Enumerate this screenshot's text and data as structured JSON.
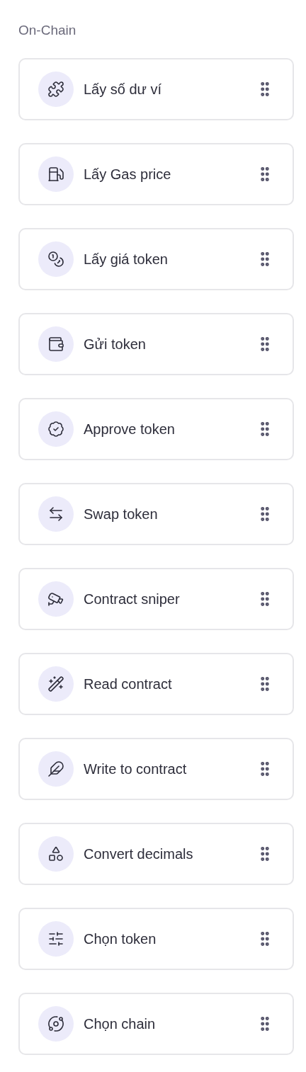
{
  "section": {
    "title": "On-Chain"
  },
  "items": [
    {
      "label": "Lấy số dư ví"
    },
    {
      "label": "Lấy Gas price"
    },
    {
      "label": "Lấy giá token"
    },
    {
      "label": "Gửi token"
    },
    {
      "label": "Approve token"
    },
    {
      "label": "Swap token"
    },
    {
      "label": "Contract sniper"
    },
    {
      "label": "Read contract"
    },
    {
      "label": "Write to contract"
    },
    {
      "label": "Convert decimals"
    },
    {
      "label": "Chọn token"
    },
    {
      "label": "Chọn chain"
    }
  ]
}
